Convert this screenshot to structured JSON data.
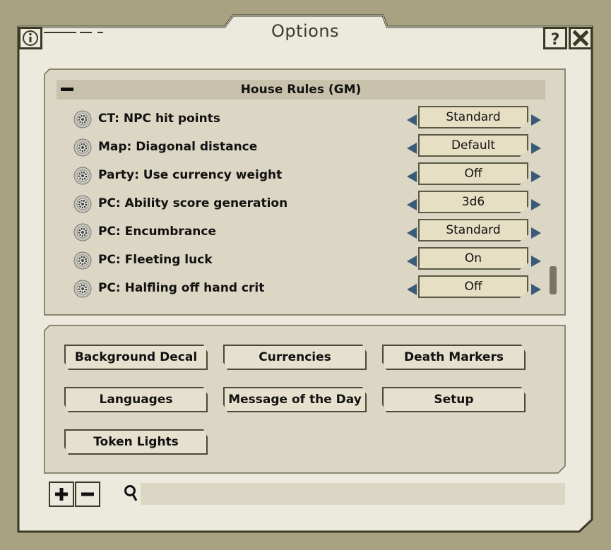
{
  "window": {
    "title": "Options"
  },
  "icons": {
    "info": "info-icon",
    "help": "help-icon",
    "close": "close-icon",
    "search": "search-icon",
    "zoom_in": "plus-icon",
    "zoom_out": "minus-icon",
    "option_gear": "gear-icon"
  },
  "colors": {
    "background": "#a8a283",
    "frame": "#ece9dd",
    "border": "#3a3a24",
    "panel": "#dcd6c4",
    "arrow": "#3a5a7a"
  },
  "group": {
    "title": "House Rules (GM)",
    "collapsed": false
  },
  "options": [
    {
      "label": "CT: NPC hit points",
      "value": "Standard"
    },
    {
      "label": "Map: Diagonal distance",
      "value": "Default"
    },
    {
      "label": "Party: Use currency weight",
      "value": "Off"
    },
    {
      "label": "PC: Ability score generation",
      "value": "3d6"
    },
    {
      "label": "PC: Encumbrance",
      "value": "Standard"
    },
    {
      "label": "PC: Fleeting luck",
      "value": "On"
    },
    {
      "label": "PC: Halfling off hand crit",
      "value": "Off"
    }
  ],
  "buttons": [
    "Background Decal",
    "Currencies",
    "Death Markers",
    "Languages",
    "Message of the Day",
    "Setup",
    "Token Lights"
  ],
  "search": {
    "value": "",
    "placeholder": ""
  }
}
